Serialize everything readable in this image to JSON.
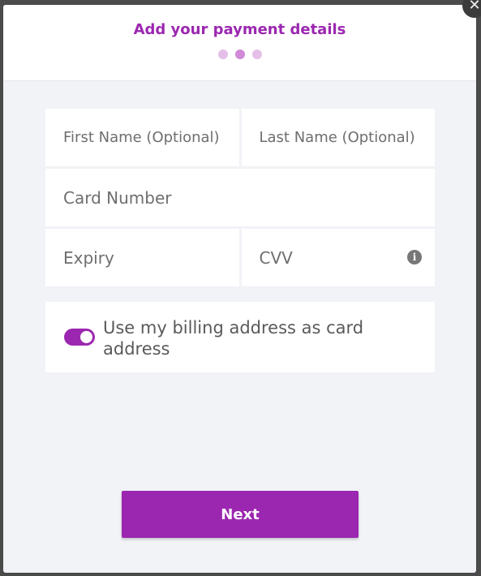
{
  "modal": {
    "title": "Add your payment details",
    "step_dots": [
      {
        "active": false
      },
      {
        "active": true
      },
      {
        "active": false
      }
    ],
    "close_glyph": "✕"
  },
  "form": {
    "first_name_placeholder": "First Name (Optional)",
    "last_name_placeholder": "Last Name (Optional)",
    "card_number_placeholder": "Card Number",
    "expiry_placeholder": "Expiry",
    "cvv_placeholder": "CVV",
    "cvv_info_icon": "info-icon"
  },
  "billing": {
    "toggle_on": true,
    "label": "Use my billing address as card address"
  },
  "actions": {
    "next_label": "Next"
  },
  "colors": {
    "accent": "#9b27b0",
    "dot_inactive": "#e5bfe8",
    "dot_active": "#d08ad6",
    "modal_bg": "#f2f3f7"
  }
}
